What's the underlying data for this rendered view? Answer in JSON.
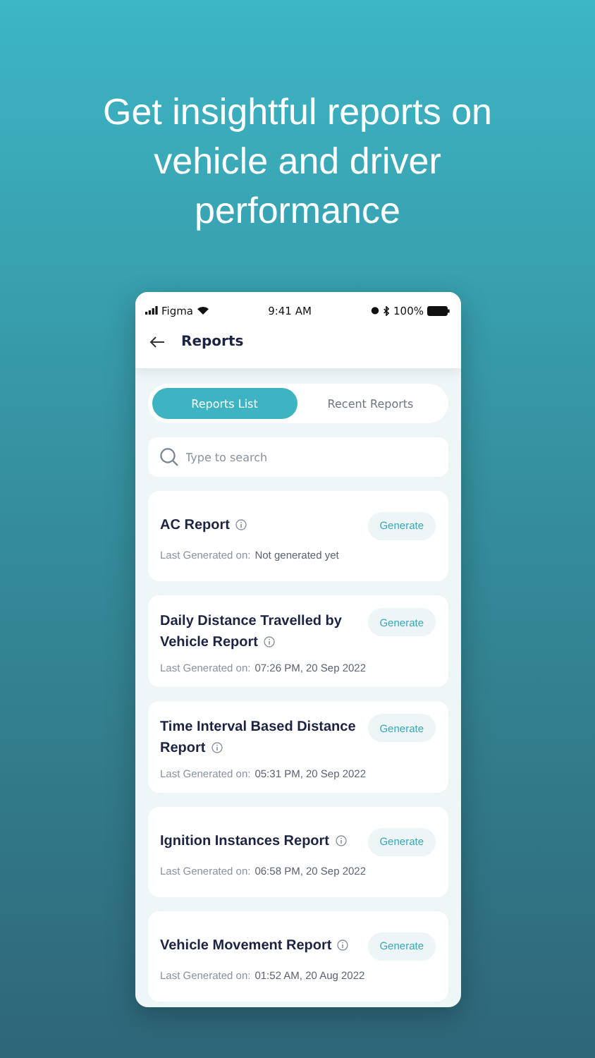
{
  "headline": "Get insightful reports on vehicle and driver performance",
  "status_bar": {
    "carrier": "Figma",
    "time": "9:41 AM",
    "battery": "100%"
  },
  "header": {
    "title": "Reports"
  },
  "tabs": [
    {
      "label": "Reports List",
      "selected": true
    },
    {
      "label": "Recent Reports",
      "selected": false
    }
  ],
  "search": {
    "placeholder": "Type to search"
  },
  "reports": [
    {
      "title": "AC Report",
      "last_label": "Last Generated on:",
      "last_value": "Not generated yet",
      "button": "Generate"
    },
    {
      "title": "Daily Distance Travelled by Vehicle Report",
      "last_label": "Last Generated on:",
      "last_value": "07:26 PM, 20 Sep 2022",
      "button": "Generate"
    },
    {
      "title": "Time Interval Based Distance Report",
      "last_label": "Last Generated on:",
      "last_value": "05:31 PM, 20 Sep 2022",
      "button": "Generate"
    },
    {
      "title": "Ignition Instances Report",
      "last_label": "Last Generated on:",
      "last_value": "06:58 PM, 20 Sep 2022",
      "button": "Generate"
    },
    {
      "title": "Vehicle Movement Report",
      "last_label": "Last Generated on:",
      "last_value": "01:52 AM, 20 Aug 2022",
      "button": "Generate"
    }
  ]
}
